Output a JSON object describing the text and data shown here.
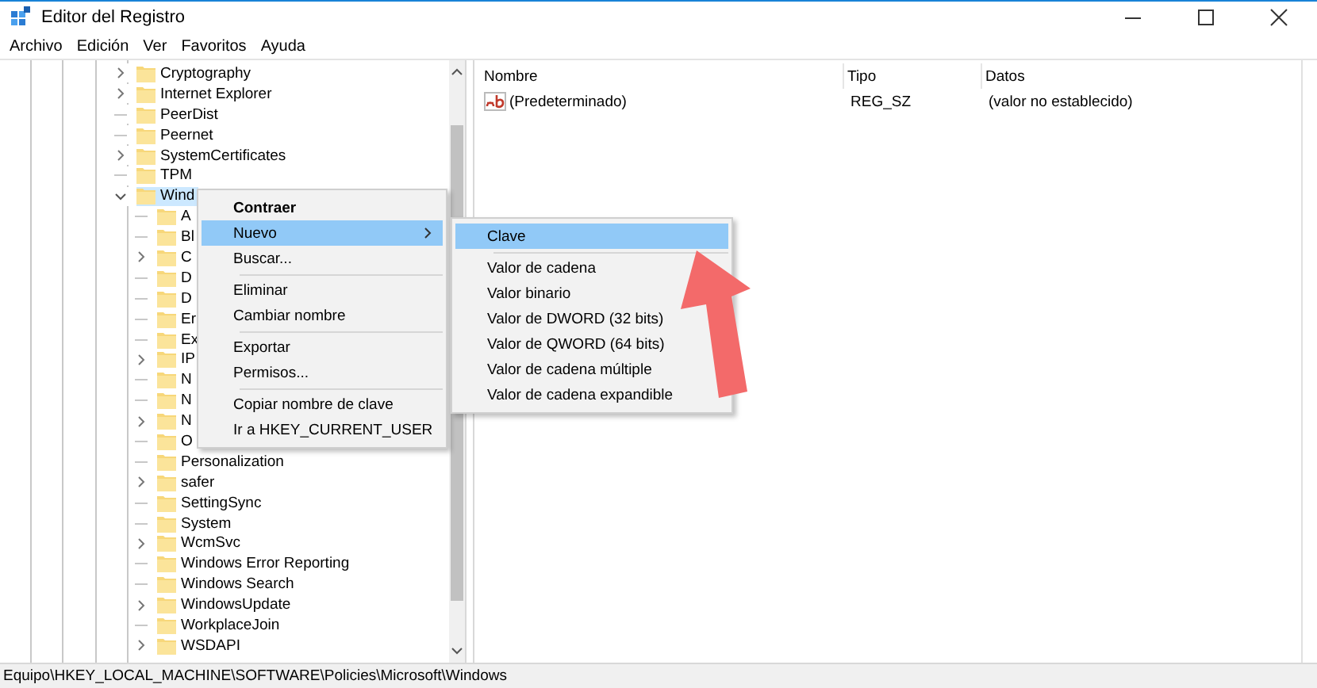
{
  "window": {
    "title": "Editor del Registro"
  },
  "menu_bar": [
    "Archivo",
    "Edición",
    "Ver",
    "Favoritos",
    "Ayuda"
  ],
  "tree": [
    {
      "label": "Cryptography",
      "expandable": true,
      "expanded": false,
      "selected": false
    },
    {
      "label": "Internet Explorer",
      "expandable": true,
      "expanded": false,
      "selected": false
    },
    {
      "label": "PeerDist",
      "expandable": false,
      "selected": false
    },
    {
      "label": "Peernet",
      "expandable": false,
      "selected": false
    },
    {
      "label": "SystemCertificates",
      "expandable": true,
      "expanded": false,
      "selected": false
    },
    {
      "label": "TPM",
      "expandable": false,
      "selected": false
    },
    {
      "label": "Wind",
      "expandable": true,
      "expanded": true,
      "selected": true,
      "children": [
        {
          "label": "A",
          "expandable": false,
          "selected": false
        },
        {
          "label": "Bl",
          "expandable": false,
          "selected": false
        },
        {
          "label": "C",
          "expandable": true,
          "expanded": false,
          "selected": false
        },
        {
          "label": "D",
          "expandable": false,
          "selected": false
        },
        {
          "label": "D",
          "expandable": false,
          "selected": false
        },
        {
          "label": "Er",
          "expandable": false,
          "selected": false
        },
        {
          "label": "Ex",
          "expandable": false,
          "selected": false
        },
        {
          "label": "IP",
          "expandable": true,
          "expanded": false,
          "selected": false
        },
        {
          "label": "N",
          "expandable": false,
          "selected": false
        },
        {
          "label": "N",
          "expandable": false,
          "selected": false
        },
        {
          "label": "N",
          "expandable": true,
          "expanded": false,
          "selected": false
        },
        {
          "label": "O",
          "expandable": false,
          "selected": false
        },
        {
          "label": "Personalization",
          "expandable": false,
          "selected": false
        },
        {
          "label": "safer",
          "expandable": true,
          "expanded": false,
          "selected": false
        },
        {
          "label": "SettingSync",
          "expandable": false,
          "selected": false
        },
        {
          "label": "System",
          "expandable": false,
          "selected": false
        },
        {
          "label": "WcmSvc",
          "expandable": true,
          "expanded": false,
          "selected": false
        },
        {
          "label": "Windows Error Reporting",
          "expandable": false,
          "selected": false
        },
        {
          "label": "Windows Search",
          "expandable": false,
          "selected": false
        },
        {
          "label": "WindowsUpdate",
          "expandable": true,
          "expanded": false,
          "selected": false
        },
        {
          "label": "WorkplaceJoin",
          "expandable": false,
          "selected": false
        },
        {
          "label": "WSDAPI",
          "expandable": true,
          "expanded": false,
          "selected": false
        }
      ]
    }
  ],
  "table": {
    "columns": [
      "Nombre",
      "Tipo",
      "Datos"
    ],
    "rows": [
      {
        "name": "(Predeterminado)",
        "type": "REG_SZ",
        "data": "(valor no establecido)"
      }
    ]
  },
  "context_menu": [
    {
      "kind": "item",
      "label": "Contraer",
      "default": true,
      "submenu": false,
      "selected": false
    },
    {
      "kind": "item",
      "label": "Nuevo",
      "default": false,
      "submenu": true,
      "selected": true
    },
    {
      "kind": "item",
      "label": "Buscar...",
      "default": false,
      "submenu": false,
      "selected": false
    },
    {
      "kind": "separator"
    },
    {
      "kind": "item",
      "label": "Eliminar",
      "default": false,
      "submenu": false,
      "selected": false
    },
    {
      "kind": "item",
      "label": "Cambiar nombre",
      "default": false,
      "submenu": false,
      "selected": false
    },
    {
      "kind": "separator"
    },
    {
      "kind": "item",
      "label": "Exportar",
      "default": false,
      "submenu": false,
      "selected": false
    },
    {
      "kind": "item",
      "label": "Permisos...",
      "default": false,
      "submenu": false,
      "selected": false
    },
    {
      "kind": "separator"
    },
    {
      "kind": "item",
      "label": "Copiar nombre de clave",
      "default": false,
      "submenu": false,
      "selected": false
    },
    {
      "kind": "item",
      "label": "Ir a HKEY_CURRENT_USER",
      "default": false,
      "submenu": false,
      "selected": false
    }
  ],
  "submenu": [
    {
      "kind": "item",
      "label": "Clave",
      "selected": true
    },
    {
      "kind": "separator"
    },
    {
      "kind": "item",
      "label": "Valor de cadena",
      "selected": false
    },
    {
      "kind": "item",
      "label": "Valor binario",
      "selected": false
    },
    {
      "kind": "item",
      "label": "Valor de DWORD (32 bits)",
      "selected": false
    },
    {
      "kind": "item",
      "label": "Valor de QWORD (64 bits)",
      "selected": false
    },
    {
      "kind": "item",
      "label": "Valor de cadena múltiple",
      "selected": false
    },
    {
      "kind": "item",
      "label": "Valor de cadena expandible",
      "selected": false
    }
  ],
  "status_bar": "Equipo\\HKEY_LOCAL_MACHINE\\SOFTWARE\\Policies\\Microsoft\\Windows"
}
